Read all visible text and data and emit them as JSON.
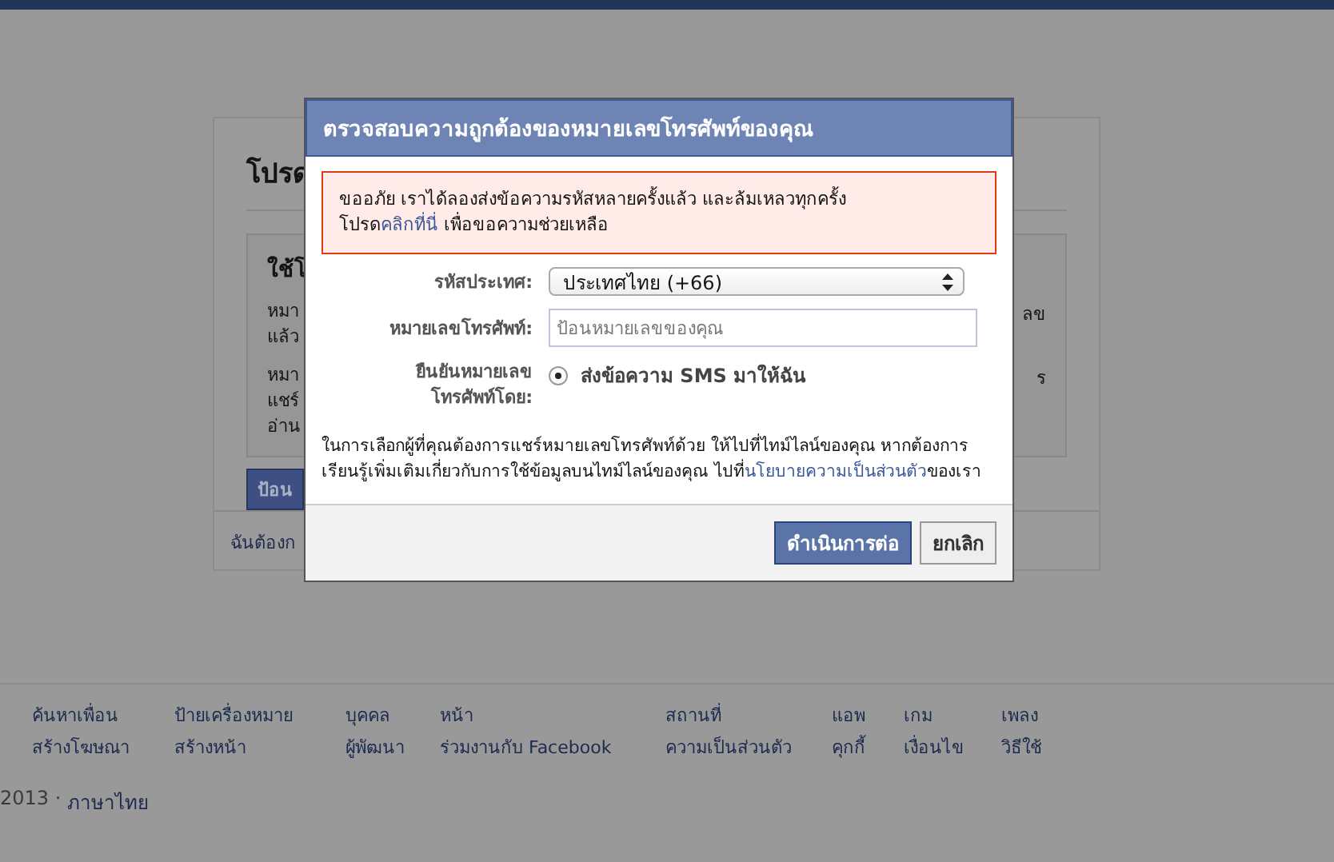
{
  "background_page": {
    "heading": "โปรด",
    "section": {
      "heading": "ใช้โ",
      "para_1": [
        "หมา",
        "แล้ว"
      ],
      "para_1_right": "ลข",
      "para_2": [
        "หมา",
        "แชร์",
        "อ่าน"
      ],
      "para_2_right": "ร"
    },
    "button": "ป้อน",
    "footer_text": "ฉันต้องก"
  },
  "dialog": {
    "title": "ตรวจสอบความถูกต้องของหมายเลขโทรศัพท์ของคุณ",
    "error": {
      "text_1": "ขออภัย เราได้ลองส่งข้อความรหัสหลายครั้งแล้ว และล้มเหลวทุกครั้ง",
      "text_2": "โปรด",
      "link": "คลิกที่นี่",
      "text_3": " เพื่อขอความช่วยเหลือ"
    },
    "country_code": {
      "label": "รหัสประเทศ:",
      "value": "ประเทศไทย (+66)"
    },
    "phone": {
      "label": "หมายเลขโทรศัพท์:",
      "placeholder": "ป้อนหมายเลขของคุณ"
    },
    "verify": {
      "label": "ยืนยันหมายเลขโทรศัพท์โดย:",
      "options": [
        {
          "label": "ส่งข้อความ SMS มาให้ฉัน",
          "selected": true
        }
      ]
    },
    "info": {
      "text": "ในการเลือกผู้ที่คุณต้องการแชร์หมายเลขโทรศัพท์ด้วย ให้ไปที่ไทม์ไลน์ของคุณ หากต้องการเรียนรู้เพิ่มเติมเกี่ยวกับการใช้ข้อมูลบนไทม์ไลน์ของคุณ ไปที่",
      "link": "นโยบายความเป็นส่วนตัว",
      "after": "ของเรา"
    },
    "buttons": {
      "continue": "ดำเนินการต่อ",
      "cancel": "ยกเลิก"
    }
  },
  "footer": {
    "columns": [
      [
        "ค้นหาเพื่อน",
        "สร้างโฆษณา"
      ],
      [
        "ป้ายเครื่องหมาย",
        "สร้างหน้า"
      ],
      [
        "บุคคล",
        "ผู้พัฒนา"
      ],
      [
        "หน้า",
        "ร่วมงานกับ Facebook"
      ],
      [
        "สถานที่",
        "ความเป็นส่วนตัว"
      ],
      [
        "แอพ",
        "คุกกี้"
      ],
      [
        "เกม",
        "เงื่อนไข"
      ],
      [
        "เพลง",
        "วิธีใช้"
      ]
    ],
    "copyright": "2013 ·",
    "language": "ภาษาไทย"
  }
}
